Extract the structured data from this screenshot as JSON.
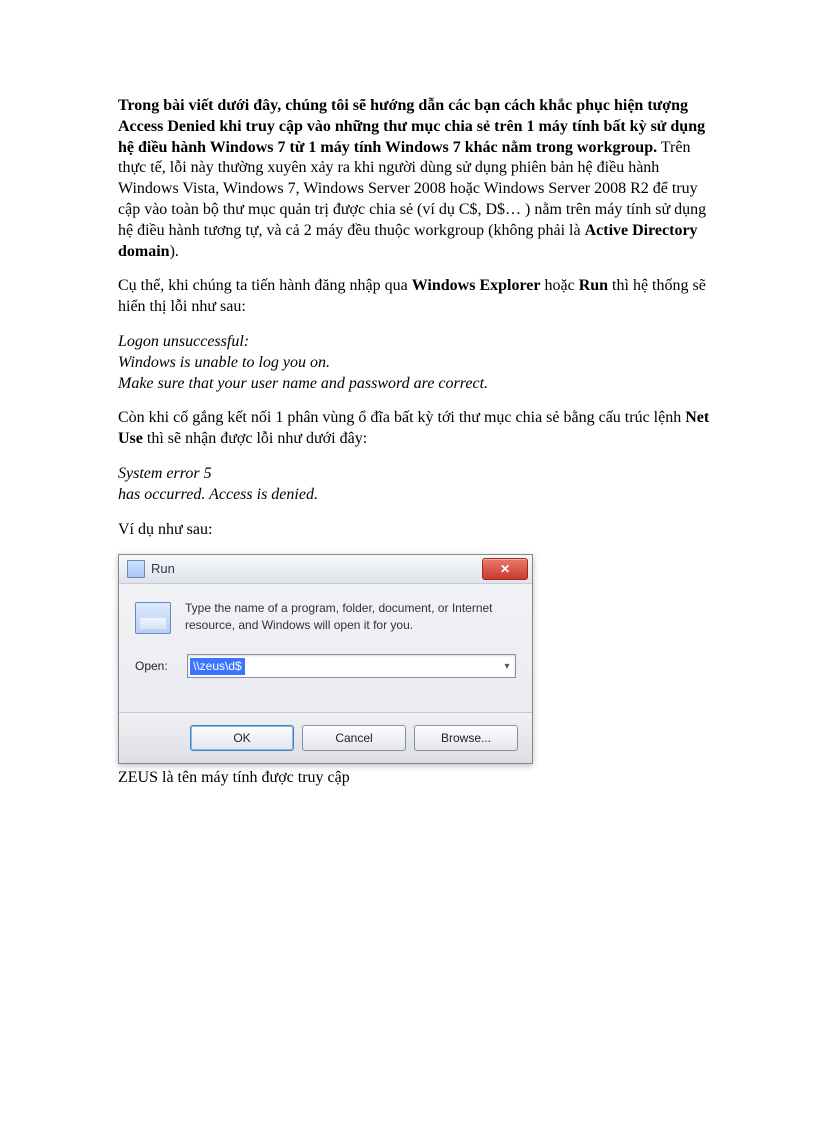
{
  "article": {
    "p1": {
      "bold": "Trong bài viết dưới đây, chúng tôi sẽ hướng dẫn các bạn cách khắc phục hiện tượng Access Denied khi truy cập vào những thư mục chia sẻ trên 1 máy tính bất kỳ sử dụng hệ điều hành Windows 7 từ 1 máy tính Windows 7 khác nằm trong workgroup.",
      "rest1": " Trên thực tế, lỗi này thường xuyên xảy ra khi người dùng sử dụng phiên bản hệ điều hành Windows Vista, Windows 7, Windows Server 2008 hoặc Windows Server 2008 R2 để truy cập vào toàn bộ thư mục quản trị được chia sẻ (ví dụ C$, D$… ) nằm trên máy tính sử dụng hệ điều hành tương tự, và cả 2 máy đều thuộc workgroup (không phải là ",
      "bold2": "Active Directory domain",
      "rest2": ")."
    },
    "p2": {
      "a": "Cụ thể, khi chúng ta tiến hành đăng nhập qua ",
      "b1": "Windows Explorer",
      "b": " hoặc ",
      "b2": "Run",
      "c": " thì hệ thống sẽ hiển thị lỗi như sau:"
    },
    "err1": {
      "l1": "Logon unsuccessful:",
      "l2": "Windows is unable to log you on.",
      "l3": "Make sure that your user name and password are correct."
    },
    "p3": {
      "a": "Còn khi cố gắng kết nối 1 phân vùng ổ đĩa bất kỳ tới thư mục chia sẻ bằng cấu trúc lệnh ",
      "b1": "Net Use",
      "b": " thì sẽ nhận được lỗi như dưới đây:"
    },
    "err2": {
      "l1": "System error 5",
      "l2": "has occurred. Access is denied."
    },
    "p4": "Ví dụ như sau:",
    "caption": "ZEUS là tên máy tính được truy cập"
  },
  "run_dialog": {
    "title": "Run",
    "description": "Type the name of a program, folder, document, or Internet resource, and Windows will open it for you.",
    "open_label": "Open:",
    "input_value": "\\\\zeus\\d$",
    "buttons": {
      "ok": "OK",
      "cancel": "Cancel",
      "browse": "Browse..."
    }
  }
}
